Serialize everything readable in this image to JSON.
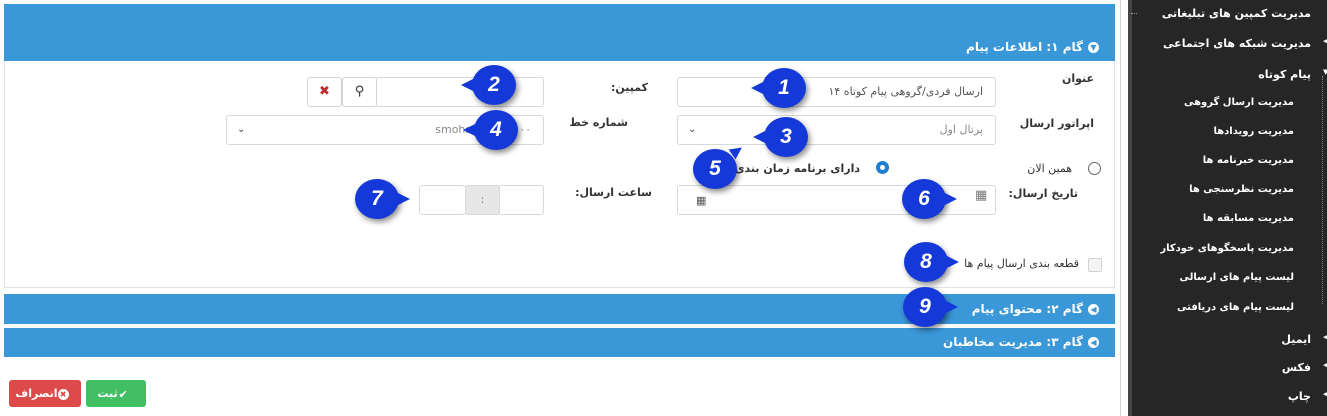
{
  "steps": {
    "step1": {
      "label": "گام ۱: اطلاعات پیام"
    },
    "step2": {
      "label": "گام ۲: محتوای پیام"
    },
    "step3": {
      "label": "گام ۳: مدیریت مخاطبان"
    }
  },
  "form": {
    "title_label": "عنوان",
    "title_value": "ارسال فردی/گروهی پیام کوتاه ۱۴",
    "campaign_label": "کمپین:",
    "campaign_value": "",
    "operator_label": "اپراتور ارسال",
    "operator_value": "پرتال اول",
    "line_label": "شماره خط",
    "line_value": "smohsenh۶۱:۳۰۰۰",
    "now_label": "همین الان",
    "scheduled_label": "دارای برنامه زمان بندی",
    "send_date_label": "تاریخ ارسال:",
    "send_date_value": "",
    "send_time_label": "ساعت ارسال:",
    "time_separator": ":",
    "time_hour": "",
    "time_minute": "",
    "chunking_label": "قطعه بندی ارسال پیام ها",
    "schedule_selected": "scheduled"
  },
  "buttons": {
    "save_label": "ثبت",
    "cancel_label": "انصراف"
  },
  "badges": [
    "1",
    "2",
    "3",
    "4",
    "5",
    "6",
    "7",
    "8",
    "9"
  ],
  "sidebar": {
    "items": [
      {
        "label": "مدیریت کمپین های تبلیغاتی"
      },
      {
        "label": "مدیریت شبکه های اجتماعی"
      },
      {
        "label": "پیام کوتاه"
      },
      {
        "label": "ایمیل"
      },
      {
        "label": "فکس"
      },
      {
        "label": "چاپ"
      }
    ],
    "subitems": [
      {
        "label": "مدیریت ارسال گروهی"
      },
      {
        "label": "مدیریت رویدادها"
      },
      {
        "label": "مدیریت خبرنامه ها"
      },
      {
        "label": "مدیریت نظرسنجی ها"
      },
      {
        "label": "مدیریت مسابقه ها"
      },
      {
        "label": "مدیریت پاسخگوهای خودکار"
      },
      {
        "label": "لیست پیام های ارسالی"
      },
      {
        "label": "لیست پیام های دریافتی"
      }
    ]
  },
  "colors": {
    "header_blue": "#3a97d8",
    "badge_blue": "#1439d8",
    "save_green": "#43bf63",
    "cancel_red": "#dd4a4a",
    "sidebar_bg": "#262626"
  }
}
